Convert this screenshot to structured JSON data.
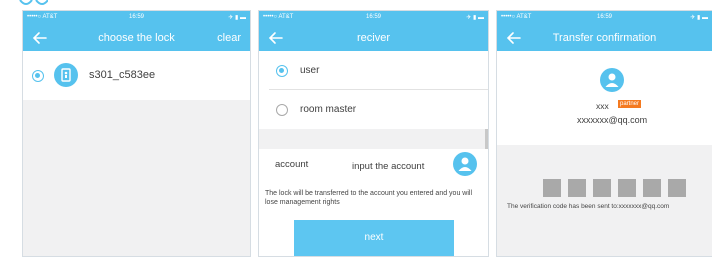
{
  "colors": {
    "accent": "#56c2ee",
    "button": "#5dc6f1",
    "highlight": "#f47a20"
  },
  "status_bar": {
    "carrier": "•••••○ AT&T",
    "time": "16:59",
    "battery": "✈ ▮ ▬"
  },
  "screen1": {
    "title": "choose the lock",
    "right_action": "clear",
    "lock_name": "s301_c583ee"
  },
  "screen2": {
    "title": "reciver",
    "options": [
      {
        "label": "user",
        "selected": true
      },
      {
        "label": "room master",
        "selected": false
      }
    ],
    "account_label": "account",
    "account_placeholder": "input the account",
    "warning": "The lock will be transferred to the account you entered and you will lose management rights",
    "next_label": "next"
  },
  "screen3": {
    "title": "Transfer confirmation",
    "user_name": "xxx",
    "partner_tag": "partner",
    "email": "xxxxxxx@qq.com",
    "sent_text": "The verification code has been sent to:xxxxxxx@qq.com"
  }
}
